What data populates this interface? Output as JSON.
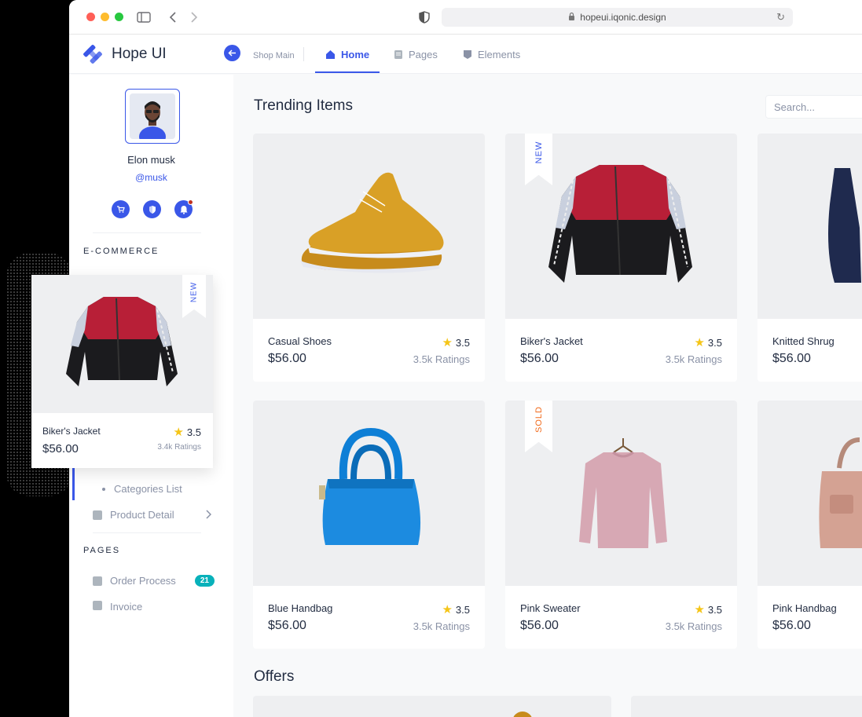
{
  "browser": {
    "url": "hopeui.iqonic.design",
    "traffic_colors": [
      "#FF5F57",
      "#FEBC2E",
      "#28C840"
    ]
  },
  "header": {
    "brand": "Hope UI",
    "breadcrumb": "Shop Main",
    "nav": [
      {
        "label": "Home",
        "icon": "home-icon",
        "active": true
      },
      {
        "label": "Pages",
        "icon": "pages-icon",
        "active": false
      },
      {
        "label": "Elements",
        "icon": "elements-icon",
        "active": false
      }
    ]
  },
  "sidebar": {
    "user_name": "Elon musk",
    "user_handle": "@musk",
    "quick_icons": [
      "cart-icon",
      "shield-icon",
      "bell-icon"
    ],
    "section_ecommerce": "E-COMMERCE",
    "categories_list": "Categories List",
    "product_detail": "Product Detail",
    "section_pages": "PAGES",
    "order_process": "Order Process",
    "order_badge": "21",
    "invoice": "Invoice"
  },
  "main": {
    "title": "Trending Items",
    "search_placeholder": "Search...",
    "offers_title": "Offers",
    "items": [
      {
        "name": "Casual Shoes",
        "price": "$56.00",
        "rating": "3.5",
        "count": "3.5k Ratings",
        "tag": ""
      },
      {
        "name": "Biker's Jacket",
        "price": "$56.00",
        "rating": "3.5",
        "count": "3.5k Ratings",
        "tag": "NEW"
      },
      {
        "name": "Knitted Shrug",
        "price": "$56.00",
        "rating": "",
        "count": "",
        "tag": ""
      },
      {
        "name": "Blue Handbag",
        "price": "$56.00",
        "rating": "3.5",
        "count": "3.5k Ratings",
        "tag": ""
      },
      {
        "name": "Pink Sweater",
        "price": "$56.00",
        "rating": "3.5",
        "count": "3.5k Ratings",
        "tag": "SOLD"
      },
      {
        "name": "Pink Handbag",
        "price": "$56.00",
        "rating": "",
        "count": "",
        "tag": ""
      }
    ]
  },
  "floating_card": {
    "name": "Biker's Jacket",
    "price": "$56.00",
    "rating": "3.5",
    "count": "3.4k Ratings",
    "tag": "NEW"
  },
  "colors": {
    "primary": "#3A57E8",
    "new_tag": "#3A57E8",
    "sold_tag": "#F16A1B",
    "star": "#F5C518",
    "badge": "#08B1BA"
  }
}
